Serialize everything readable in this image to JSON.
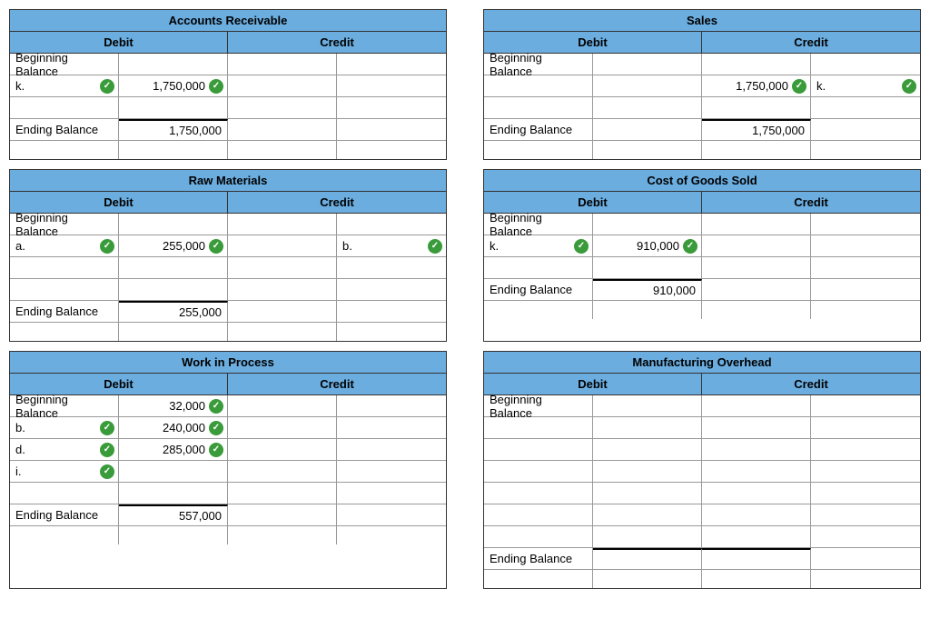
{
  "common": {
    "debit": "Debit",
    "credit": "Credit",
    "beginning": "Beginning Balance",
    "ending": "Ending Balance"
  },
  "accounts": {
    "ar": {
      "title": "Accounts Receivable",
      "r1_label": "k.",
      "r1_amt": "1,750,000",
      "end_debit": "1,750,000"
    },
    "sales": {
      "title": "Sales",
      "r1_credit_amt": "1,750,000",
      "r1_credit_label": "k.",
      "end_credit": "1,750,000"
    },
    "rm": {
      "title": "Raw Materials",
      "r1_label": "a.",
      "r1_amt": "255,000",
      "r1_credit_label": "b.",
      "end_debit": "255,000"
    },
    "cogs": {
      "title": "Cost of Goods Sold",
      "r1_label": "k.",
      "r1_amt": "910,000",
      "end_debit": "910,000"
    },
    "wip": {
      "title": "Work in Process",
      "beg_amt": "32,000",
      "r1_label": "b.",
      "r1_amt": "240,000",
      "r2_label": "d.",
      "r2_amt": "285,000",
      "r3_label": "i.",
      "end_debit": "557,000"
    },
    "moh": {
      "title": "Manufacturing Overhead"
    }
  }
}
